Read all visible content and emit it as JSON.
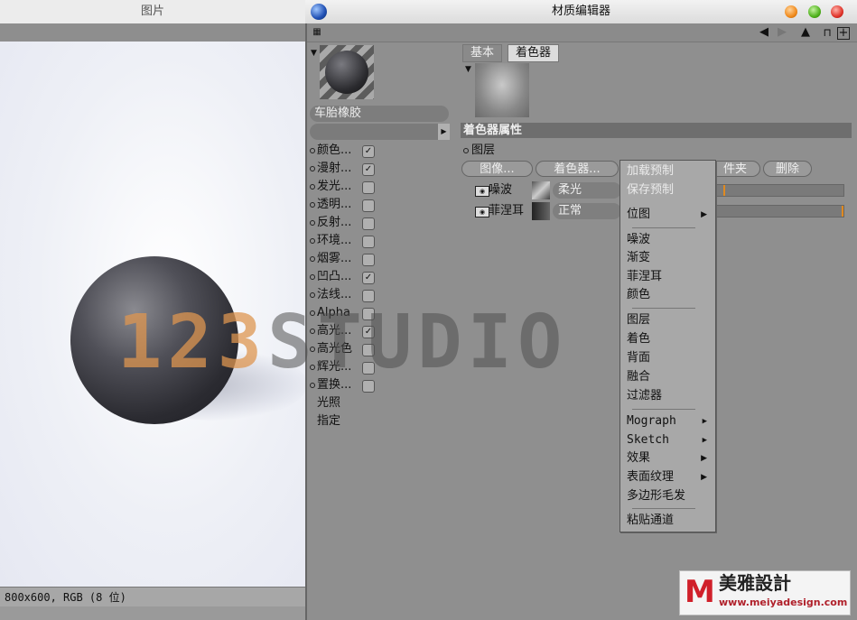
{
  "viewer": {
    "title": "图片",
    "status": "800x600, RGB (8 位)"
  },
  "editor": {
    "title": "材质编辑器",
    "material_name": "车胎橡胶",
    "channels": [
      {
        "label": "颜色...",
        "checked": true
      },
      {
        "label": "漫射...",
        "checked": true
      },
      {
        "label": "发光...",
        "checked": false
      },
      {
        "label": "透明...",
        "checked": false
      },
      {
        "label": "反射...",
        "checked": false
      },
      {
        "label": "环境...",
        "checked": false
      },
      {
        "label": "烟雾...",
        "checked": false
      },
      {
        "label": "凹凸...",
        "checked": true
      },
      {
        "label": "法线...",
        "checked": false
      },
      {
        "label": "Alpha",
        "checked": false
      },
      {
        "label": "高光...",
        "checked": true
      },
      {
        "label": "高光色",
        "checked": false
      },
      {
        "label": "辉光...",
        "checked": false
      },
      {
        "label": "置换...",
        "checked": false
      }
    ],
    "extra_items": [
      "光照",
      "指定"
    ],
    "tabs": [
      "基本",
      "着色器"
    ],
    "section_title": "着色器属性",
    "layer_heading": "图层",
    "buttons": {
      "image": "图像...",
      "shader": "着色器...",
      "folder": "件夹",
      "delete": "删除"
    },
    "layers": [
      {
        "name": "噪波",
        "mode": "柔光"
      },
      {
        "name": "菲涅耳",
        "mode": "正常"
      }
    ],
    "check_mark": "✓"
  },
  "menu": {
    "items": [
      {
        "label": "加载预制",
        "disabled": true,
        "submenu": false
      },
      {
        "label": "保存预制",
        "disabled": true,
        "submenu": false
      },
      {
        "label": "位图",
        "disabled": false,
        "submenu": true
      },
      {
        "label": "噪波",
        "disabled": false,
        "submenu": false
      },
      {
        "label": "渐变",
        "disabled": false,
        "submenu": false
      },
      {
        "label": "菲涅耳",
        "disabled": false,
        "submenu": false
      },
      {
        "label": "颜色",
        "disabled": false,
        "submenu": false
      },
      {
        "label": "图层",
        "disabled": false,
        "submenu": false
      },
      {
        "label": "着色",
        "disabled": false,
        "submenu": false
      },
      {
        "label": "背面",
        "disabled": false,
        "submenu": false
      },
      {
        "label": "融合",
        "disabled": false,
        "submenu": false
      },
      {
        "label": "过滤器",
        "disabled": false,
        "submenu": false
      },
      {
        "label": "Mograph",
        "disabled": false,
        "submenu": true
      },
      {
        "label": "Sketch",
        "disabled": false,
        "submenu": true
      },
      {
        "label": "效果",
        "disabled": false,
        "submenu": true
      },
      {
        "label": "表面纹理",
        "disabled": false,
        "submenu": true
      },
      {
        "label": "多边形毛发",
        "disabled": false,
        "submenu": false
      },
      {
        "label": "粘贴通道",
        "disabled": false,
        "submenu": false
      }
    ]
  },
  "watermark": {
    "number": "123",
    "text": "STUDIO"
  },
  "logo": {
    "title": "美雅設計",
    "url": "www.meiyadesign.com"
  },
  "colors": {
    "accent_orange": "#de9650",
    "logo_red": "#d0202a"
  }
}
